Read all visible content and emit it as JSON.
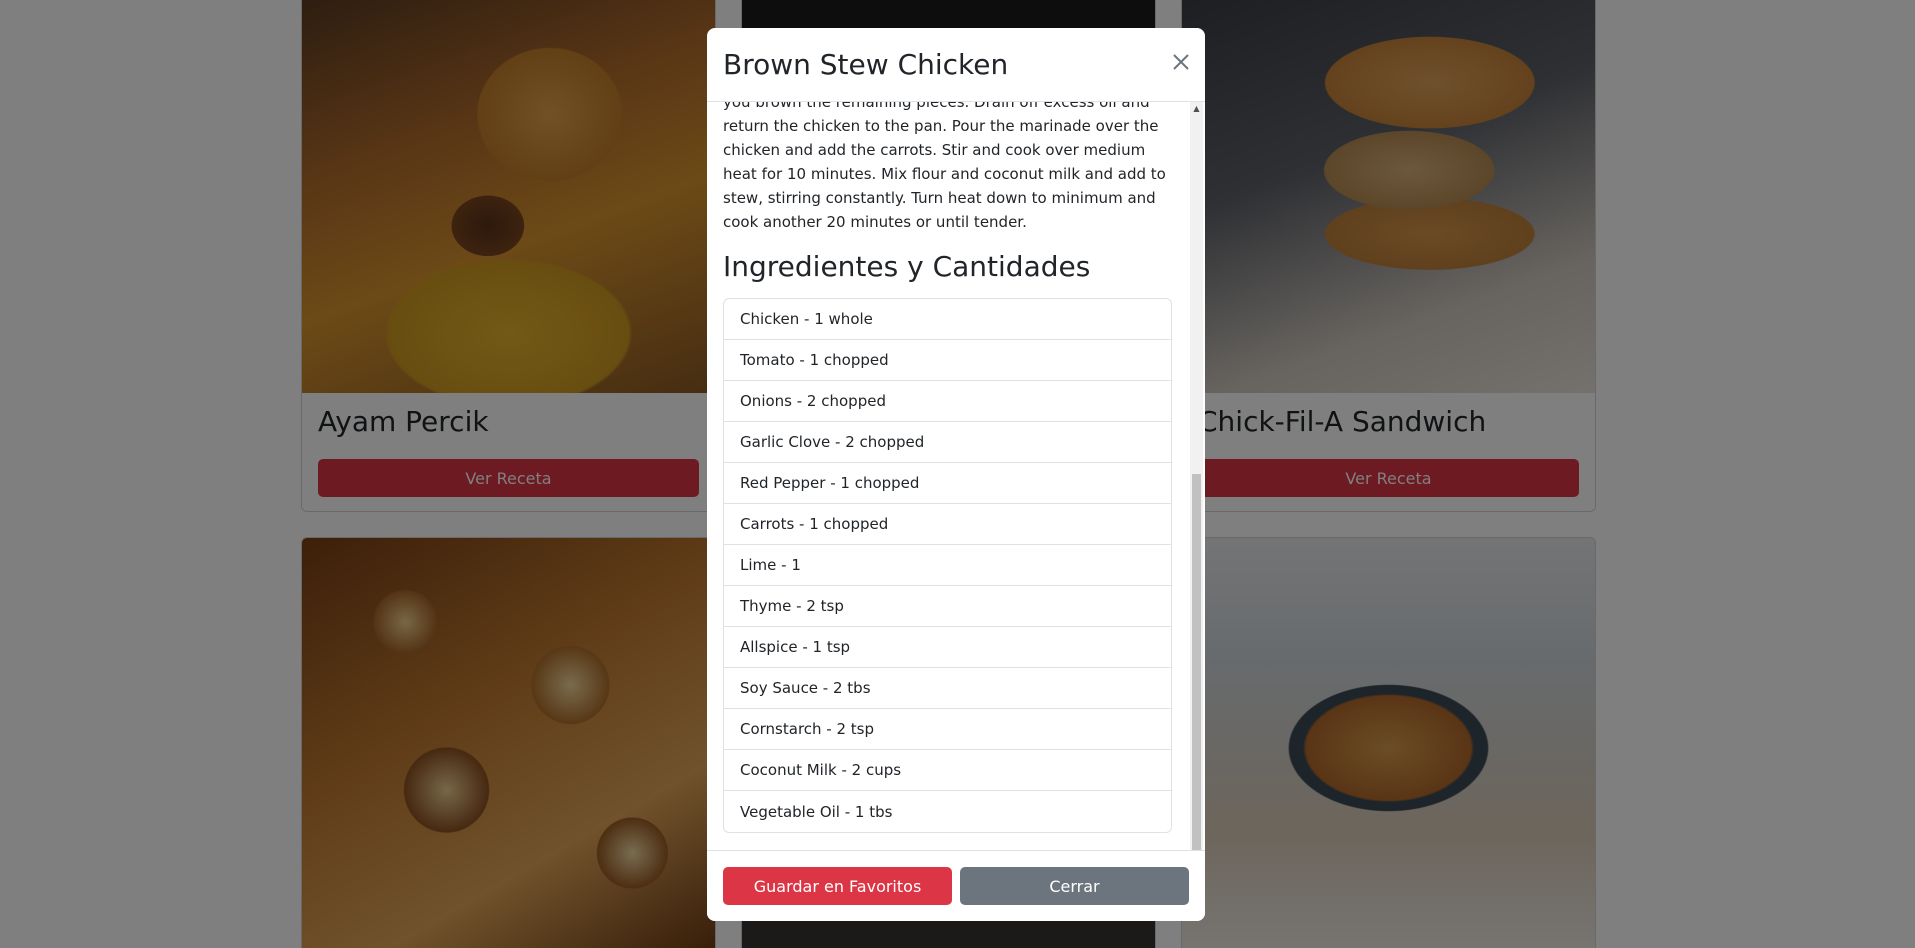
{
  "background": {
    "cards": [
      {
        "title": "Ayam Percik",
        "button": "Ver Receta"
      },
      {
        "title": "",
        "button": ""
      },
      {
        "title": "Chick-Fil-A Sandwich",
        "button": "Ver Receta"
      }
    ]
  },
  "modal": {
    "title": "Brown Stew Chicken",
    "instructions": "you brown the remaining pieces. Drain off excess oil and return the chicken to the pan. Pour the marinade over the chicken and add the carrots. Stir and cook over medium heat for 10 minutes. Mix flour and coconut milk and add to stew, stirring constantly. Turn heat down to minimum and cook another 20 minutes or until tender.",
    "ingredients_heading": "Ingredientes y Cantidades",
    "ingredients": [
      "Chicken - 1 whole",
      "Tomato - 1 chopped",
      "Onions - 2 chopped",
      "Garlic Clove - 2 chopped",
      "Red Pepper - 1 chopped",
      "Carrots - 1 chopped",
      "Lime - 1",
      "Thyme - 2 tsp",
      "Allspice - 1 tsp",
      "Soy Sauce - 2 tbs",
      "Cornstarch - 2 tsp",
      "Coconut Milk - 2 cups",
      "Vegetable Oil - 1 tbs"
    ],
    "footer": {
      "save_label": "Guardar en Favoritos",
      "close_label": "Cerrar"
    }
  },
  "colors": {
    "danger": "#dc3545",
    "secondary": "#6c757d"
  }
}
